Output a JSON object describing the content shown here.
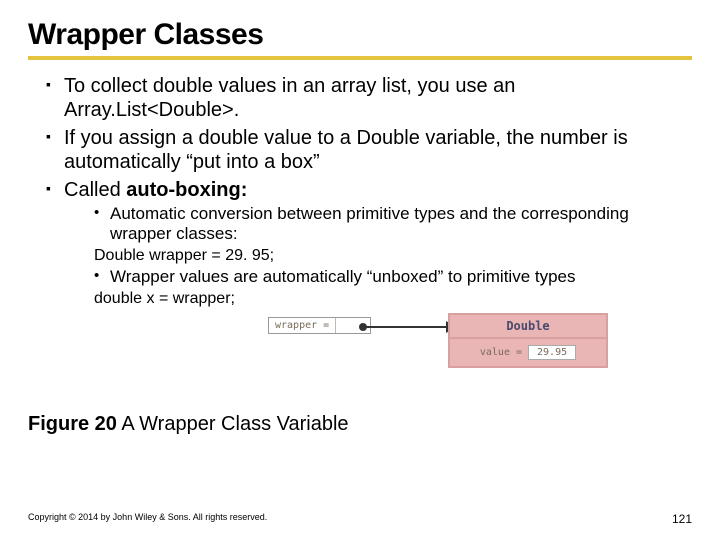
{
  "title": "Wrapper Classes",
  "bullets": {
    "b1_a": "To collect double values in an array list, you use an ",
    "b1_b": "Array.List<Double>.",
    "b2_a": "If you assign a ",
    "b2_b": "double",
    "b2_c": " value to a ",
    "b2_d": "Double",
    "b2_e": " variable, the number is automatically “put into a box”",
    "b3_a": "Called ",
    "b3_b": "auto-boxing:"
  },
  "sub": {
    "s1": "Automatic conversion between primitive types and the corresponding wrapper classes:",
    "code1": "Double wrapper = 29. 95;",
    "s2": "Wrapper values are automatically “unboxed” to primitive types",
    "code2": "double x = wrapper;"
  },
  "diagram": {
    "wrapper_label": "wrapper =",
    "double_label": "Double",
    "value_label": "value =",
    "value": "29.95"
  },
  "figure": {
    "label": "Figure 20",
    "caption": " A Wrapper Class Variable"
  },
  "footer": {
    "copyright": "Copyright © 2014 by John Wiley & Sons. All rights reserved.",
    "page": "121"
  }
}
